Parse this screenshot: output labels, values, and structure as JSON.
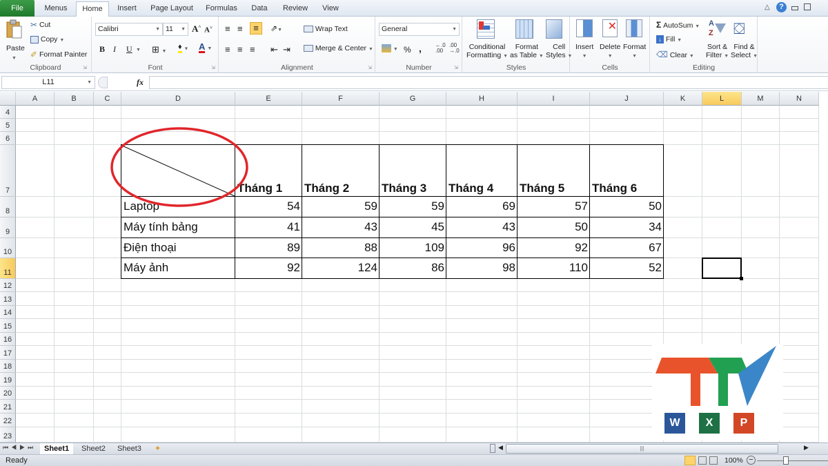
{
  "ribbon_tabs": [
    "File",
    "Menus",
    "Home",
    "Insert",
    "Page Layout",
    "Formulas",
    "Data",
    "Review",
    "View"
  ],
  "active_tab": "Home",
  "clipboard": {
    "paste": "Paste",
    "cut": "Cut",
    "copy": "Copy",
    "format_painter": "Format Painter",
    "label": "Clipboard"
  },
  "font": {
    "name": "Calibri",
    "size": "11",
    "bold": "B",
    "italic": "I",
    "underline": "U",
    "label": "Font"
  },
  "alignment": {
    "wrap_text": "Wrap Text",
    "merge_center": "Merge & Center",
    "label": "Alignment"
  },
  "number": {
    "format": "General",
    "percent": "%",
    "comma": ",",
    "label": "Number"
  },
  "styles": {
    "conditional_1": "Conditional",
    "conditional_2": "Formatting",
    "format_table_1": "Format",
    "format_table_2": "as Table",
    "cell_styles_1": "Cell",
    "cell_styles_2": "Styles",
    "label": "Styles"
  },
  "cells": {
    "insert": "Insert",
    "delete": "Delete",
    "format": "Format",
    "label": "Cells"
  },
  "editing": {
    "autosum": "AutoSum",
    "fill": "Fill",
    "clear": "Clear",
    "sort_1": "Sort &",
    "sort_2": "Filter",
    "find_1": "Find &",
    "find_2": "Select",
    "label": "Editing"
  },
  "formula_bar": {
    "name_box": "L11",
    "fx": "fx",
    "formula": ""
  },
  "columns": [
    "A",
    "B",
    "C",
    "D",
    "E",
    "F",
    "G",
    "H",
    "I",
    "J",
    "K",
    "L",
    "M",
    "N"
  ],
  "selected_column": "L",
  "rows": [
    "4",
    "5",
    "6",
    "7",
    "8",
    "9",
    "10",
    "11",
    "12",
    "13",
    "14",
    "15",
    "16",
    "17",
    "18",
    "19",
    "20",
    "21",
    "22",
    "23"
  ],
  "selected_row": "11",
  "table": {
    "headers": [
      "Tháng 1",
      "Tháng 2",
      "Tháng 3",
      "Tháng 4",
      "Tháng 5",
      "Tháng 6"
    ],
    "rows": [
      {
        "label": "Laptop",
        "values": [
          "54",
          "59",
          "59",
          "69",
          "57",
          "50"
        ]
      },
      {
        "label": "Máy tính bảng",
        "values": [
          "41",
          "43",
          "45",
          "43",
          "50",
          "34"
        ]
      },
      {
        "label": "Điện thoại",
        "values": [
          "89",
          "88",
          "109",
          "96",
          "92",
          "67"
        ]
      },
      {
        "label": "Máy ảnh",
        "values": [
          "92",
          "124",
          "86",
          "98",
          "110",
          "52"
        ]
      }
    ]
  },
  "annotation": {
    "shape": "red-ellipse",
    "color": "#e0262b"
  },
  "logo": {
    "letters": "TTV",
    "colors": {
      "t1": "#e9532b",
      "t2": "#21a052",
      "v": "#3b86c8"
    },
    "apps": [
      "W",
      "X",
      "P"
    ]
  },
  "sheets": [
    "Sheet1",
    "Sheet2",
    "Sheet3"
  ],
  "active_sheet": "Sheet1",
  "status": {
    "ready": "Ready",
    "zoom": "100%"
  }
}
